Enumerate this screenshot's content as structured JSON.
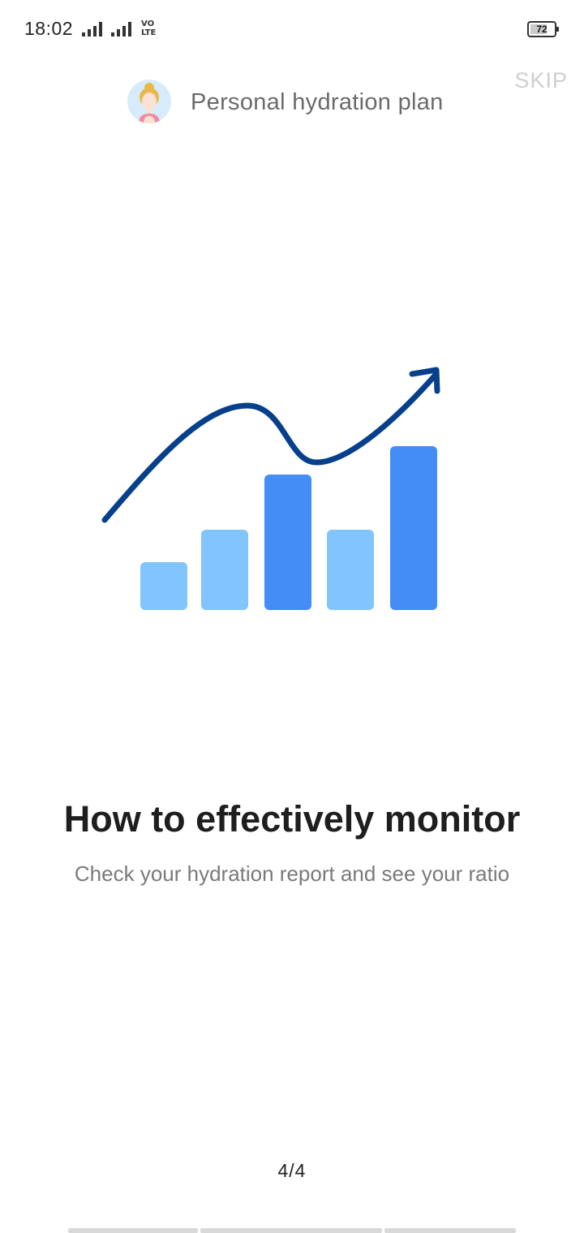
{
  "status_bar": {
    "time": "18:02",
    "volte_line1": "VO",
    "volte_line2": "LTE",
    "battery_level": "72"
  },
  "header": {
    "title": "Personal hydration plan",
    "skip_label": "SKIP",
    "avatar_icon": "woman-avatar-icon"
  },
  "illustration": {
    "icon": "growth-bar-chart-icon",
    "colors": {
      "light_bar": "#82c4fd",
      "dark_bar": "#448cf6",
      "trend_line": "#063f8c"
    }
  },
  "content": {
    "title": "How to effectively monitor",
    "subtitle": "Check your hydration report and see your ratio"
  },
  "pager": {
    "indicator": "4/4",
    "current_page": 4,
    "total_pages": 4
  }
}
